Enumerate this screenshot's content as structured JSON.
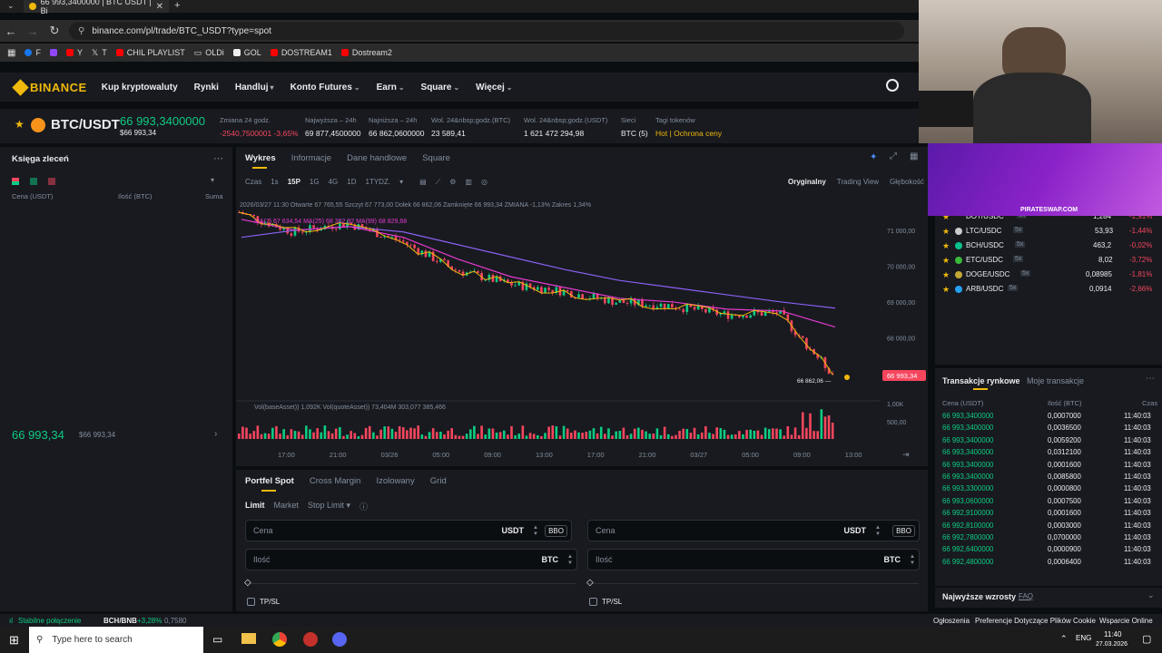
{
  "browser": {
    "tab_title": "66 993,3400000 | BTC USDT | Bi",
    "url": "binance.com/pl/trade/BTC_USDT?type=spot",
    "bookmarks": [
      "F",
      "Y",
      "T",
      "CHIL PLAYLIST",
      "OLDi",
      "GOL",
      "DOSTREAM1",
      "Dostream2"
    ]
  },
  "header": {
    "brand": "BINANCE",
    "nav": [
      "Kup kryptowaluty",
      "Rynki",
      "Handluj",
      "Konto Futures",
      "Earn",
      "Square",
      "Więcej"
    ]
  },
  "ticker": {
    "pair": "BTC/USDT",
    "price": "66 993,3400000",
    "price_sub": "$66 993,34",
    "stats": [
      {
        "label": "Zmiana 24 godz.",
        "value": "-2540,7500001 -3,65%",
        "color": "#f6465d"
      },
      {
        "label": "Najwyższa – 24h",
        "value": "69 877,4500000",
        "color": "#eaecef"
      },
      {
        "label": "Najniższa – 24h",
        "value": "66 862,0600000",
        "color": "#eaecef"
      },
      {
        "label": "Wol. 24&nbsp;godz.(BTC)",
        "value": "23 589,41",
        "color": "#eaecef"
      },
      {
        "label": "Wol. 24&nbsp;godz.(USDT)",
        "value": "1 621 472 294,98",
        "color": "#eaecef"
      },
      {
        "label": "Sieci",
        "value": "BTC (5)",
        "color": "#eaecef"
      },
      {
        "label": "Tagi tokenów",
        "value": "Hot | Ochrona ceny",
        "color": "#f0b90b"
      }
    ]
  },
  "orderbook": {
    "title": "Księga zleceń",
    "col_price": "Cena (USDT)",
    "col_qty": "Ilość (BTC)",
    "col_sum": "Suma",
    "last_price": "66 993,34",
    "last_price_sub": "$66 993,34"
  },
  "chart_tabs": {
    "tabs": [
      "Wykres",
      "Informacje",
      "Dane handlowe",
      "Square"
    ],
    "intervals_label": "Czas",
    "intervals": [
      "1s",
      "15P",
      "1G",
      "4G",
      "1D",
      "1TYDZ."
    ],
    "views": [
      "Oryginalny",
      "Trading View",
      "Głębokość"
    ]
  },
  "chart_info": {
    "ohlc": "2026/03/27 11:30 Otwarte 67 765,55 Szczyt 67 773,00 Dołek 66 862,06 Zamknięte 66 993,34 ZMIANA -1,13% Zakres 1,34%",
    "ma": "MA(7) 67 634,54  MA(25) 68 302,92  MA(99) 68 829,68",
    "vol": "Vol(baseAsset)) 1,092K  Vol(quoteAsset)) 73,404M  303,077  385,466",
    "price_tag": "66 993,34",
    "low_label": "66 862,06 —",
    "y_ticks": [
      "71 000,00",
      "70 000,00",
      "69 000,00",
      "68 000,00"
    ],
    "vol_ticks": [
      "1,00K",
      "500,00"
    ],
    "x_ticks": [
      "17:00",
      "21:00",
      "03/26",
      "05:00",
      "09:00",
      "13:00",
      "17:00",
      "21:00",
      "03/27",
      "05:00",
      "09:00",
      "13:00"
    ]
  },
  "chart_data": {
    "type": "line",
    "title": "",
    "xlabel": "",
    "ylabel": "",
    "ylim": [
      66700,
      71500
    ],
    "x": [
      "17:00",
      "21:00",
      "03/26",
      "05:00",
      "09:00",
      "13:00",
      "17:00",
      "21:00",
      "03/27",
      "05:00",
      "09:00",
      "11:30"
    ],
    "series": [
      {
        "name": "",
        "values": [
          71500,
          70950,
          71200,
          70700,
          69900,
          69500,
          69300,
          69000,
          68900,
          68650,
          68700,
          66993
        ]
      },
      {
        "name": "MA(25)",
        "values": [
          71300,
          71000,
          71100,
          70800,
          70200,
          69700,
          69400,
          69100,
          69000,
          68800,
          68750,
          68302
        ]
      },
      {
        "name": "MA(99)",
        "values": [
          70800,
          71000,
          71100,
          70950,
          70600,
          70250,
          69900,
          69600,
          69400,
          69200,
          69000,
          68829
        ]
      }
    ]
  },
  "order_form": {
    "tabs": [
      "Portfel Spot",
      "Cross Margin",
      "Izolowany",
      "Grid"
    ],
    "types": [
      "Limit",
      "Market",
      "Stop Limit"
    ],
    "price_placeholder": "Cena",
    "qty_placeholder": "Ilość",
    "unit_quote": "USDT",
    "unit_base": "BTC",
    "bbo": "BBO",
    "tpsl": "TP/SL"
  },
  "markets": [
    {
      "pair": "DOT/USDC",
      "lev": "5x",
      "price": "1,284",
      "chg": "-1,91%"
    },
    {
      "pair": "LTC/USDC",
      "lev": "5x",
      "price": "53,93",
      "chg": "-1,44%"
    },
    {
      "pair": "BCH/USDC",
      "lev": "5x",
      "price": "463,2",
      "chg": "-0,02%"
    },
    {
      "pair": "ETC/USDC",
      "lev": "5x",
      "price": "8,02",
      "chg": "-3,72%"
    },
    {
      "pair": "DOGE/USDC",
      "lev": "5x",
      "price": "0,08985",
      "chg": "-1,81%"
    },
    {
      "pair": "ARB/USDC",
      "lev": "5x",
      "price": "0,0914",
      "chg": "-2,66%"
    }
  ],
  "trades": {
    "tabs": [
      "Transakcje rynkowe",
      "Moje transakcje"
    ],
    "col_price": "Cena (USDT)",
    "col_qty": "Ilość (BTC)",
    "col_time": "Czas",
    "rows": [
      {
        "price": "66 993,3400000",
        "qty": "0,0007000",
        "time": "11:40:03"
      },
      {
        "price": "66 993,3400000",
        "qty": "0,0036500",
        "time": "11:40:03"
      },
      {
        "price": "66 993,3400000",
        "qty": "0,0059200",
        "time": "11:40:03"
      },
      {
        "price": "66 993,3400000",
        "qty": "0,0312100",
        "time": "11:40:03"
      },
      {
        "price": "66 993,3400000",
        "qty": "0,0001600",
        "time": "11:40:03"
      },
      {
        "price": "66 993,3400000",
        "qty": "0,0085800",
        "time": "11:40:03"
      },
      {
        "price": "66 993,3300000",
        "qty": "0,0000800",
        "time": "11:40:03"
      },
      {
        "price": "66 993,0600000",
        "qty": "0,0007500",
        "time": "11:40:03"
      },
      {
        "price": "66 992,9100000",
        "qty": "0,0001600",
        "time": "11:40:03"
      },
      {
        "price": "66 992,8100000",
        "qty": "0,0003000",
        "time": "11:40:03"
      },
      {
        "price": "66 992,7800000",
        "qty": "0,0700000",
        "time": "11:40:03"
      },
      {
        "price": "66 992,6400000",
        "qty": "0,0000900",
        "time": "11:40:03"
      },
      {
        "price": "66 992,4800000",
        "qty": "0,0006400",
        "time": "11:40:03"
      }
    ],
    "gainers_title": "Najwyższe wzrosty",
    "faq": "FAQ"
  },
  "ad": {
    "text": "PIRATESWAP.COM"
  },
  "status": {
    "connection": "Stabilne połączenie",
    "ticker": "BCH/BNB",
    "ticker_chg": "+3,28%",
    "ticker_val": "0,7580",
    "links": [
      "Ogłoszenia",
      "Preferencje Dotyczące Plików Cookie",
      "Wsparcie Online"
    ]
  },
  "taskbar": {
    "search_placeholder": "Type here to search",
    "lang": "ENG",
    "time": "11:40",
    "date": "27.03.2026"
  }
}
